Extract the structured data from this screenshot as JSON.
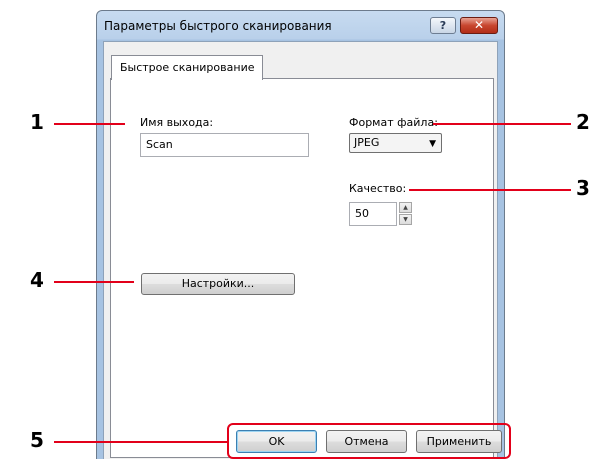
{
  "window": {
    "title": "Параметры быстрого сканирования",
    "help_glyph": "?",
    "close_glyph": "✕"
  },
  "tabs": [
    {
      "label": "Быстрое сканирование",
      "selected": true
    }
  ],
  "output_name": {
    "label": "Имя выхода:",
    "value": "Scan"
  },
  "file_format": {
    "label": "Формат файла:",
    "selected": "JPEG"
  },
  "quality": {
    "label": "Качество:",
    "value": "50"
  },
  "settings_button": {
    "label": "Настройки..."
  },
  "footer": {
    "ok": "OK",
    "cancel": "Отмена",
    "apply": "Применить"
  },
  "callouts": [
    "1",
    "2",
    "3",
    "4",
    "5"
  ],
  "colors": {
    "callout_line": "#e2001a",
    "close_button": "#c8462f"
  }
}
